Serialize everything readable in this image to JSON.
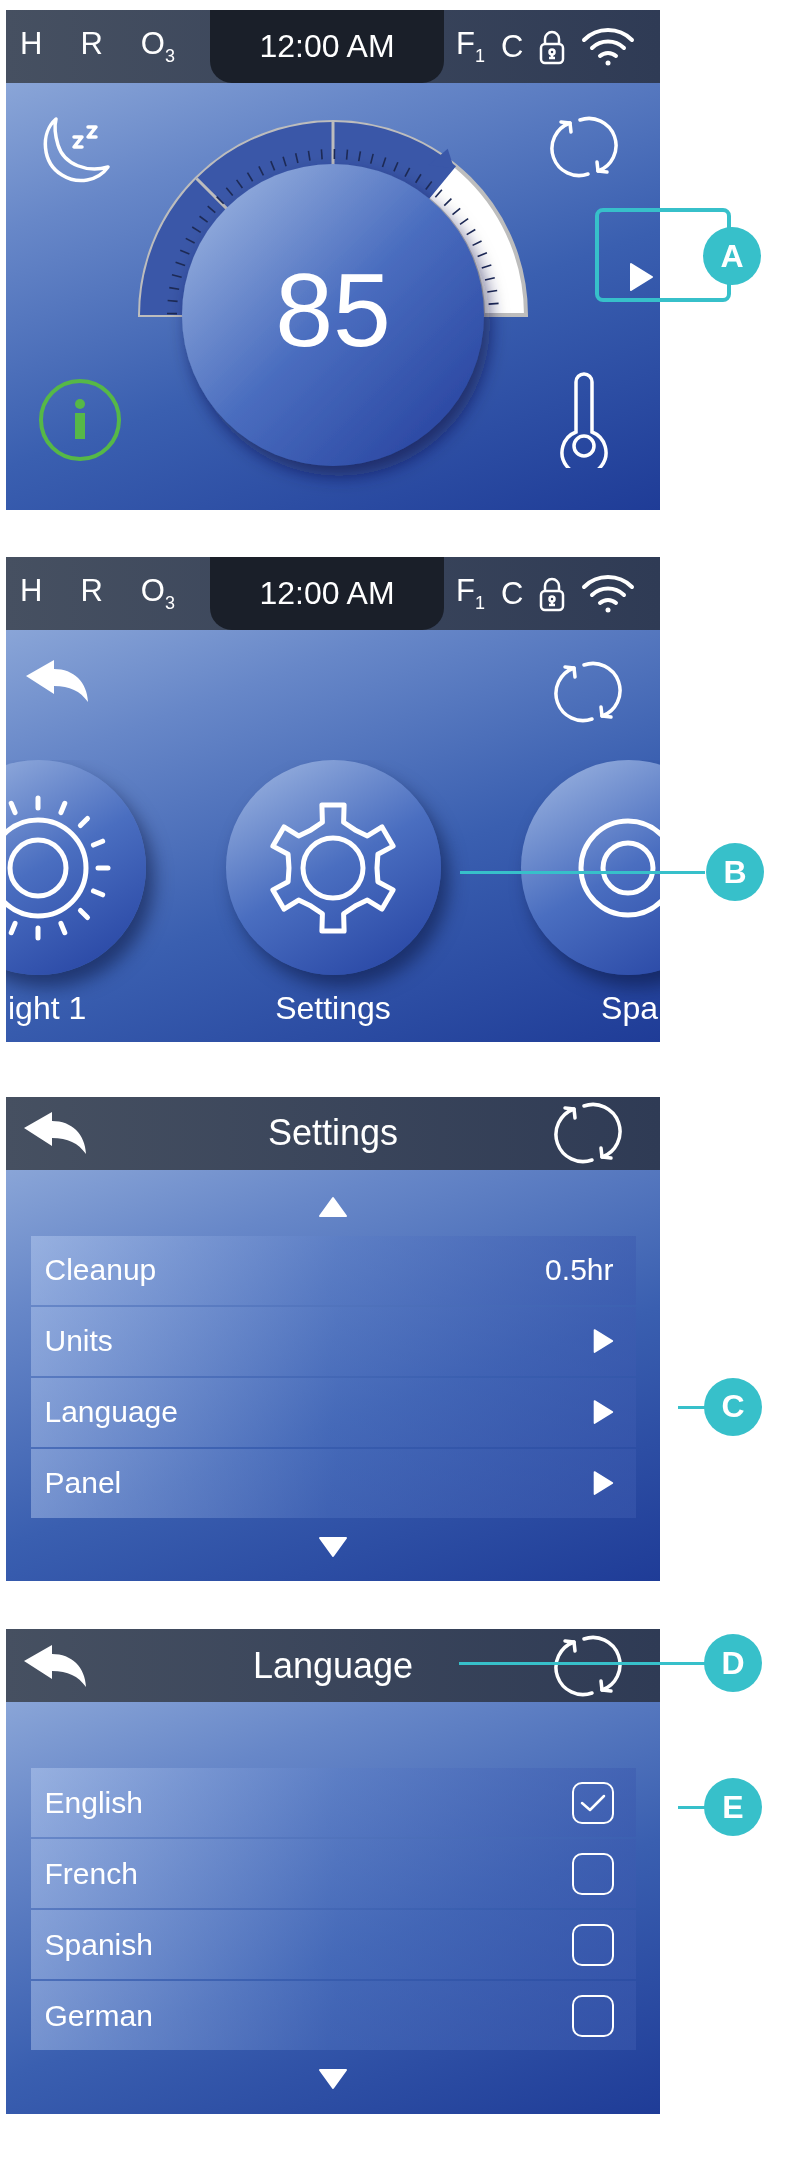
{
  "screens": [
    {
      "kind": "home",
      "status_bar": {
        "indicators": [
          "H",
          "R",
          "O$_{3}$"
        ],
        "time": "12:00 AM",
        "flags": [
          "F$_{1}$",
          "C"
        ]
      },
      "thermostat": {
        "temperature": "85"
      },
      "callouts": [
        {
          "letter": "A"
        }
      ]
    },
    {
      "kind": "carousel",
      "status_bar": {
        "indicators": [
          "H",
          "R",
          "O$_{3}$"
        ],
        "time": "12:00 AM",
        "flags": [
          "F$_{1}$",
          "C"
        ]
      },
      "items": [
        {
          "label": "ight 1",
          "kind": "light"
        },
        {
          "label": "Settings",
          "kind": "settings"
        },
        {
          "label": "Spa",
          "kind": "spa"
        }
      ],
      "callouts": [
        {
          "letter": "B"
        }
      ]
    },
    {
      "kind": "list",
      "title": "Settings",
      "scroll_up": true,
      "scroll_down": true,
      "rows": [
        {
          "label": "Cleanup",
          "kind": "value",
          "value": "0.5hr"
        },
        {
          "label": "Units",
          "kind": "submenu"
        },
        {
          "label": "Language",
          "kind": "submenu"
        },
        {
          "label": "Panel",
          "kind": "submenu"
        }
      ],
      "callouts": [
        {
          "letter": "C"
        }
      ]
    },
    {
      "kind": "list",
      "title": "Language",
      "scroll_up": false,
      "scroll_down": true,
      "rows": [
        {
          "label": "English",
          "kind": "option",
          "checked": true
        },
        {
          "label": "French",
          "kind": "option",
          "checked": false
        },
        {
          "label": "Spanish",
          "kind": "option",
          "checked": false
        },
        {
          "label": "German",
          "kind": "option",
          "checked": false
        }
      ],
      "callouts": [
        {
          "letter": "D"
        },
        {
          "letter": "E"
        }
      ]
    }
  ]
}
